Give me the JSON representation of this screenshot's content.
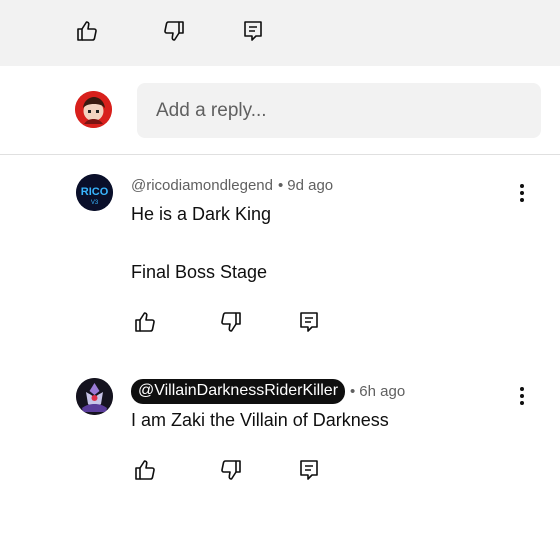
{
  "top_actions": {
    "like_icon": "thumb-up-icon",
    "dislike_icon": "thumb-down-icon",
    "reply_icon": "comment-icon"
  },
  "reply_box": {
    "placeholder": "Add a reply..."
  },
  "comments": [
    {
      "handle": "@ricodiamondlegend",
      "separator": "•",
      "time": "9d ago",
      "text": "He is a Dark King\n\nFinal Boss Stage",
      "avatar_text": "RICO",
      "avatar_subtext": "V3",
      "highlighted_handle": false
    },
    {
      "handle": "@VillainDarknessRiderKiller",
      "separator": "•",
      "time": "6h ago",
      "text": "I am Zaki the Villain of Darkness",
      "highlighted_handle": true
    }
  ],
  "colors": {
    "top_bar_bg": "#f2f2f2",
    "input_bg": "#f2f2f2",
    "secondary_text": "#606060",
    "primary_text": "#0f0f0f",
    "pill_bg": "#0f0f0f"
  }
}
